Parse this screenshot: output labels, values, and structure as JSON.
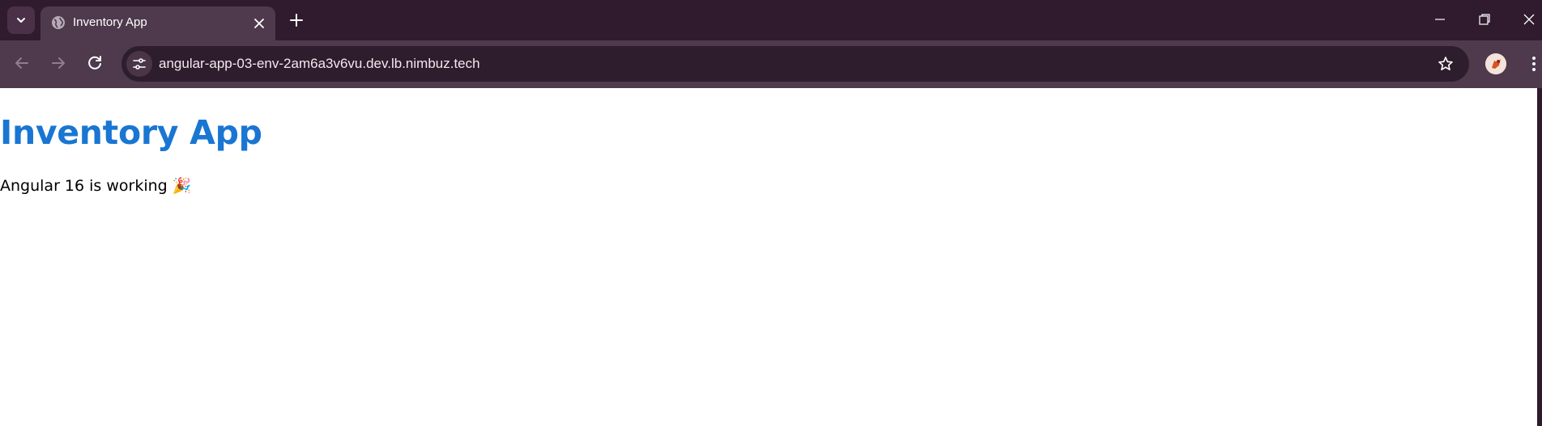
{
  "browser": {
    "tab": {
      "title": "Inventory App"
    },
    "omnibox": {
      "url": "angular-app-03-env-2am6a3v6vu.dev.lb.nimbuz.tech"
    },
    "theme": {
      "frame": "#2f1b2d",
      "toolbar": "#4e3a4c"
    }
  },
  "page": {
    "heading": "Inventory App",
    "status_text": "Angular 16 is working 🎉",
    "heading_color": "#1976d2"
  },
  "icons": {
    "tab_list": "chevron-down-icon",
    "favicon": "globe-icon",
    "tab_close": "close-icon",
    "new_tab": "plus-icon",
    "back": "arrow-left-icon",
    "forward": "arrow-right-icon",
    "reload": "reload-icon",
    "site_info": "tune-icon",
    "bookmark": "star-icon",
    "menu": "kebab-icon"
  }
}
